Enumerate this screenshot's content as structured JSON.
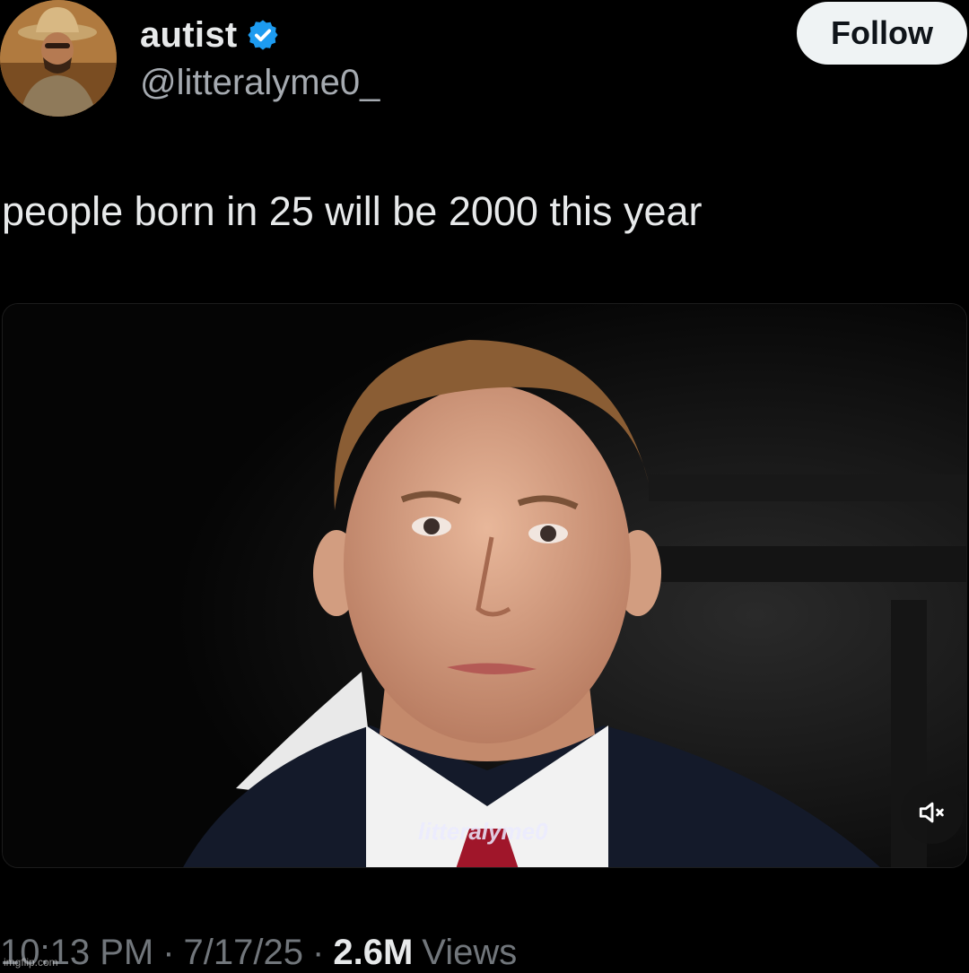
{
  "author": {
    "display_name": "autist",
    "handle": "@litteralyme0_",
    "verified": true,
    "verified_color": "#1d9bf0"
  },
  "header": {
    "follow_label": "Follow"
  },
  "tweet": {
    "text": "people born in 25 will be 2000 this year"
  },
  "media": {
    "type": "video",
    "watermark": "litteralyme0",
    "muted": true,
    "mute_icon": "volume-muted-icon"
  },
  "meta": {
    "time": "10:13 PM",
    "date": "7/17/25",
    "views_count": "2.6M",
    "views_label": "Views",
    "separator": "·"
  },
  "overlay": {
    "imgflip_watermark": "imgflip.com"
  },
  "colors": {
    "background": "#000000",
    "primary_text": "#e7e9ea",
    "secondary_text": "#71767b",
    "follow_bg": "#eff3f4"
  }
}
